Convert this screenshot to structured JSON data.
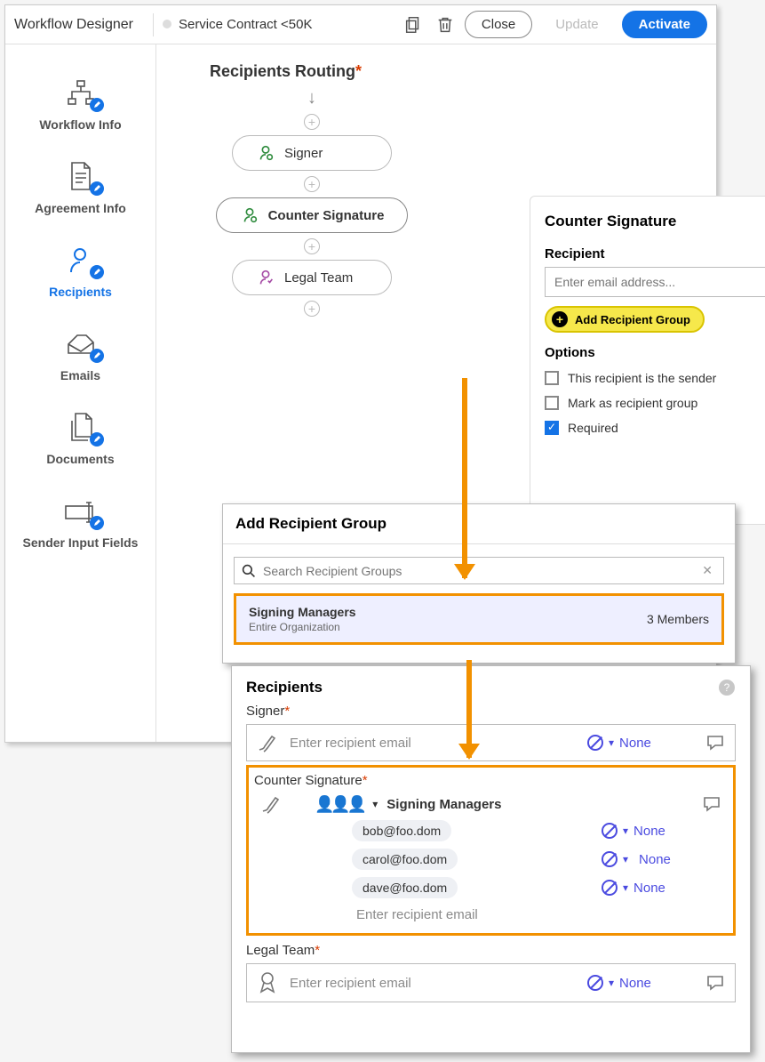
{
  "header": {
    "title": "Workflow Designer",
    "workflow_name": "Service Contract <50K",
    "close": "Close",
    "update": "Update",
    "activate": "Activate"
  },
  "sidebar": {
    "items": [
      {
        "label": "Workflow Info"
      },
      {
        "label": "Agreement Info"
      },
      {
        "label": "Recipients"
      },
      {
        "label": "Emails"
      },
      {
        "label": "Documents"
      },
      {
        "label": "Sender Input Fields"
      }
    ]
  },
  "routing": {
    "title": "Recipients Routing",
    "nodes": [
      "Signer",
      "Counter Signature",
      "Legal Team"
    ]
  },
  "panel": {
    "title": "Counter Signature",
    "recipient_label": "Recipient",
    "email_placeholder": "Enter email address...",
    "add_group": "Add Recipient Group",
    "options_label": "Options",
    "opt_sender": "This recipient is the sender",
    "opt_mark_group": "Mark as recipient group",
    "opt_required": "Required"
  },
  "group_modal": {
    "title": "Add Recipient Group",
    "search_placeholder": "Search Recipient Groups",
    "result_name": "Signing Managers",
    "result_scope": "Entire Organization",
    "result_count": "3 Members"
  },
  "send": {
    "title": "Recipients",
    "signer_label": "Signer",
    "counter_label": "Counter Signature",
    "legal_label": "Legal Team",
    "email_placeholder": "Enter recipient email",
    "group_name": "Signing Managers",
    "members": [
      "bob@foo.dom",
      "carol@foo.dom",
      "dave@foo.dom"
    ],
    "auth": "None"
  }
}
